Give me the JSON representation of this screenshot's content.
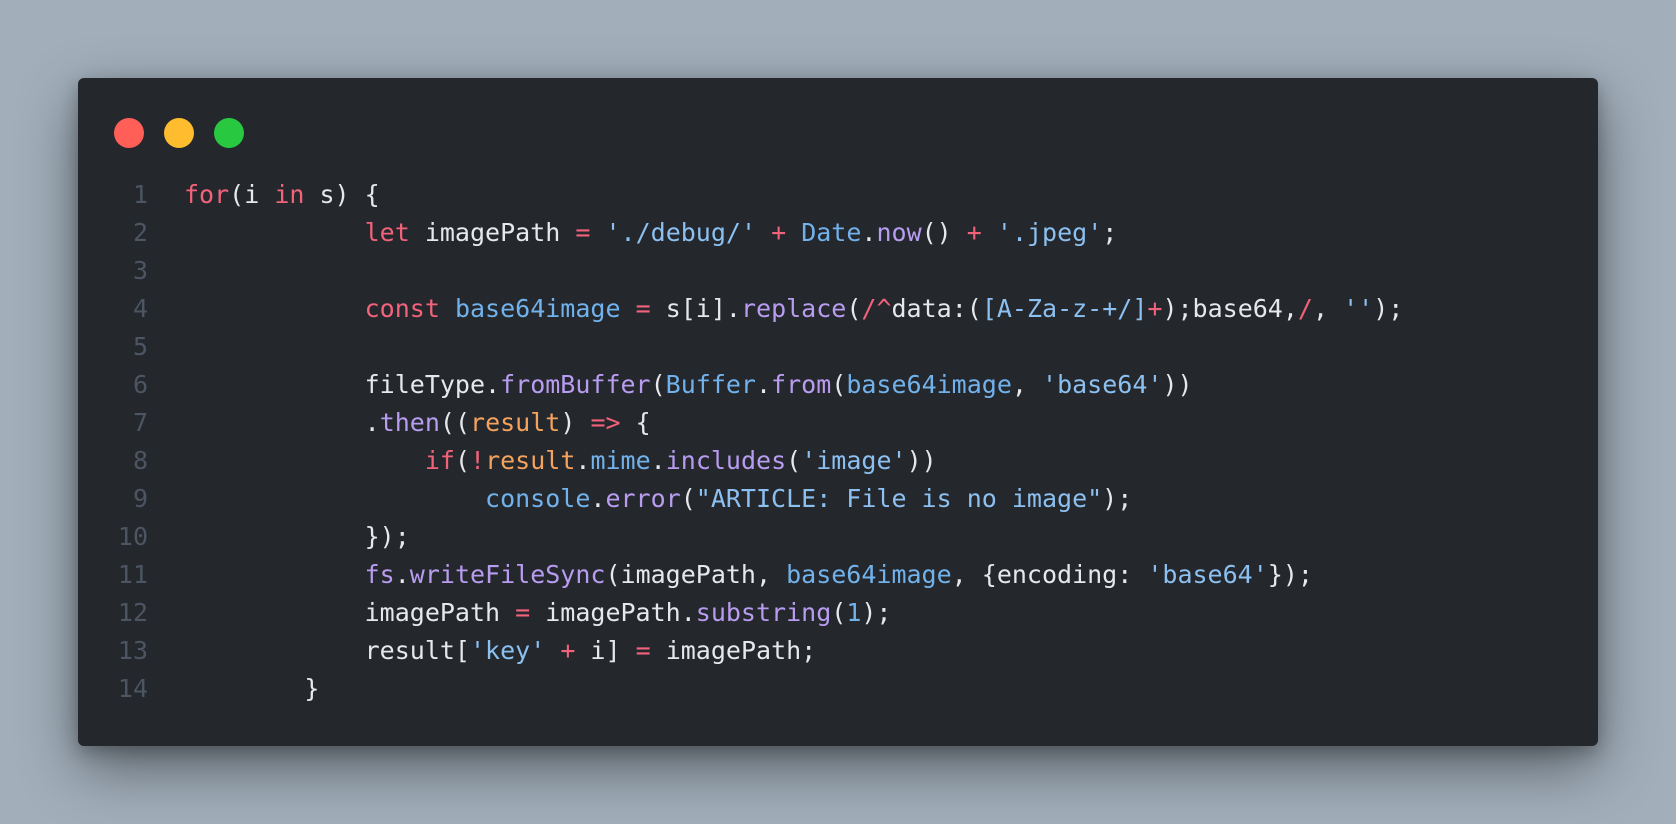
{
  "window": {
    "controls": [
      {
        "name": "close-window-button",
        "color": "#ff5f57"
      },
      {
        "name": "minimize-window-button",
        "color": "#febc2e"
      },
      {
        "name": "maximize-window-button",
        "color": "#28c840"
      }
    ]
  },
  "editor": {
    "language": "javascript",
    "lines": [
      {
        "number": "1",
        "indent": "",
        "tokens": [
          {
            "text": "for",
            "type": "kw"
          },
          {
            "text": "(i ",
            "type": "plain"
          },
          {
            "text": "in",
            "type": "kw"
          },
          {
            "text": " s) {",
            "type": "plain"
          }
        ]
      },
      {
        "number": "2",
        "indent": "            ",
        "tokens": [
          {
            "text": "let",
            "type": "kw"
          },
          {
            "text": " imagePath ",
            "type": "plain"
          },
          {
            "text": "=",
            "type": "op"
          },
          {
            "text": " ",
            "type": "plain"
          },
          {
            "text": "'./debug/'",
            "type": "str"
          },
          {
            "text": " ",
            "type": "plain"
          },
          {
            "text": "+",
            "type": "op"
          },
          {
            "text": " ",
            "type": "plain"
          },
          {
            "text": "Date",
            "type": "var"
          },
          {
            "text": ".",
            "type": "plain"
          },
          {
            "text": "now",
            "type": "fn"
          },
          {
            "text": "() ",
            "type": "plain"
          },
          {
            "text": "+",
            "type": "op"
          },
          {
            "text": " ",
            "type": "plain"
          },
          {
            "text": "'.jpeg'",
            "type": "str"
          },
          {
            "text": ";",
            "type": "plain"
          }
        ]
      },
      {
        "number": "3",
        "indent": "",
        "tokens": []
      },
      {
        "number": "4",
        "indent": "            ",
        "tokens": [
          {
            "text": "const",
            "type": "kw"
          },
          {
            "text": " ",
            "type": "plain"
          },
          {
            "text": "base64image",
            "type": "var"
          },
          {
            "text": " ",
            "type": "plain"
          },
          {
            "text": "=",
            "type": "op"
          },
          {
            "text": " s[i].",
            "type": "plain"
          },
          {
            "text": "replace",
            "type": "fn"
          },
          {
            "text": "(",
            "type": "plain"
          },
          {
            "text": "/^",
            "type": "op"
          },
          {
            "text": "data:(",
            "type": "plain"
          },
          {
            "text": "[A-Za-z-+/]",
            "type": "str"
          },
          {
            "text": "+",
            "type": "op"
          },
          {
            "text": ");base64,",
            "type": "plain"
          },
          {
            "text": "/",
            "type": "op"
          },
          {
            "text": ", ",
            "type": "plain"
          },
          {
            "text": "''",
            "type": "str"
          },
          {
            "text": ");",
            "type": "plain"
          }
        ]
      },
      {
        "number": "5",
        "indent": "",
        "tokens": []
      },
      {
        "number": "6",
        "indent": "            ",
        "tokens": [
          {
            "text": "fileType.",
            "type": "plain"
          },
          {
            "text": "fromBuffer",
            "type": "fn"
          },
          {
            "text": "(",
            "type": "plain"
          },
          {
            "text": "Buffer",
            "type": "var"
          },
          {
            "text": ".",
            "type": "plain"
          },
          {
            "text": "from",
            "type": "fn"
          },
          {
            "text": "(",
            "type": "plain"
          },
          {
            "text": "base64image",
            "type": "var"
          },
          {
            "text": ", ",
            "type": "plain"
          },
          {
            "text": "'base64'",
            "type": "str"
          },
          {
            "text": "))",
            "type": "plain"
          }
        ]
      },
      {
        "number": "7",
        "indent": "            ",
        "tokens": [
          {
            "text": ".",
            "type": "plain"
          },
          {
            "text": "then",
            "type": "fn"
          },
          {
            "text": "((",
            "type": "plain"
          },
          {
            "text": "result",
            "type": "param"
          },
          {
            "text": ") ",
            "type": "plain"
          },
          {
            "text": "=>",
            "type": "op"
          },
          {
            "text": " {",
            "type": "plain"
          }
        ]
      },
      {
        "number": "8",
        "indent": "                ",
        "tokens": [
          {
            "text": "if",
            "type": "kw"
          },
          {
            "text": "(",
            "type": "plain"
          },
          {
            "text": "!",
            "type": "op"
          },
          {
            "text": "result",
            "type": "param"
          },
          {
            "text": ".",
            "type": "plain"
          },
          {
            "text": "mime",
            "type": "var"
          },
          {
            "text": ".",
            "type": "plain"
          },
          {
            "text": "includes",
            "type": "fn"
          },
          {
            "text": "(",
            "type": "plain"
          },
          {
            "text": "'image'",
            "type": "str"
          },
          {
            "text": "))",
            "type": "plain"
          }
        ]
      },
      {
        "number": "9",
        "indent": "                    ",
        "tokens": [
          {
            "text": "console",
            "type": "var"
          },
          {
            "text": ".",
            "type": "plain"
          },
          {
            "text": "error",
            "type": "fn"
          },
          {
            "text": "(",
            "type": "plain"
          },
          {
            "text": "\"ARTICLE: File is no image\"",
            "type": "str"
          },
          {
            "text": ");",
            "type": "plain"
          }
        ]
      },
      {
        "number": "10",
        "indent": "            ",
        "tokens": [
          {
            "text": "});",
            "type": "plain"
          }
        ]
      },
      {
        "number": "11",
        "indent": "            ",
        "tokens": [
          {
            "text": "fs",
            "type": "fn"
          },
          {
            "text": ".",
            "type": "plain"
          },
          {
            "text": "writeFileSync",
            "type": "fn"
          },
          {
            "text": "(imagePath, ",
            "type": "plain"
          },
          {
            "text": "base64image",
            "type": "var"
          },
          {
            "text": ", {encoding: ",
            "type": "plain"
          },
          {
            "text": "'base64'",
            "type": "str"
          },
          {
            "text": "});",
            "type": "plain"
          }
        ]
      },
      {
        "number": "12",
        "indent": "            ",
        "tokens": [
          {
            "text": "imagePath ",
            "type": "plain"
          },
          {
            "text": "=",
            "type": "op"
          },
          {
            "text": " imagePath.",
            "type": "plain"
          },
          {
            "text": "substring",
            "type": "fn"
          },
          {
            "text": "(",
            "type": "plain"
          },
          {
            "text": "1",
            "type": "num"
          },
          {
            "text": ");",
            "type": "plain"
          }
        ]
      },
      {
        "number": "13",
        "indent": "            ",
        "tokens": [
          {
            "text": "result[",
            "type": "plain"
          },
          {
            "text": "'key'",
            "type": "str"
          },
          {
            "text": " ",
            "type": "plain"
          },
          {
            "text": "+",
            "type": "op"
          },
          {
            "text": " i] ",
            "type": "plain"
          },
          {
            "text": "=",
            "type": "op"
          },
          {
            "text": " imagePath;",
            "type": "plain"
          }
        ]
      },
      {
        "number": "14",
        "indent": "        ",
        "tokens": [
          {
            "text": "}",
            "type": "plain"
          }
        ]
      }
    ]
  }
}
